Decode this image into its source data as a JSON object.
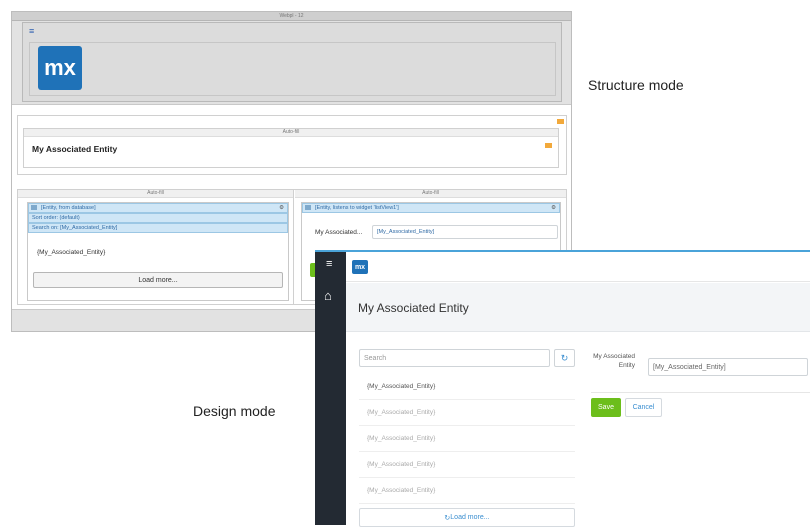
{
  "captions": {
    "structure": "Structure mode",
    "design": "Design mode"
  },
  "structure": {
    "top_header_label": "Webpl - 12",
    "menu_icon_glyph": "≡",
    "logo_text": "mx",
    "header_layout_label": "Auto-fill",
    "page_title": "My Associated Entity",
    "left_column_label": "Auto-fill",
    "right_column_label": "Auto-fill",
    "list_view": {
      "datasource": "[Entity, from database]",
      "sort_order": "Sort order: (default)",
      "search_on": "Search on: [My_Associated_Entity]",
      "item_text": "{My_Associated_Entity}",
      "load_more": "Load more..."
    },
    "data_view": {
      "datasource": "[Entity, listens to widget 'listView1']",
      "field_label": "My Associated...",
      "field_value": "[My_Associated_Entity]"
    }
  },
  "design": {
    "menu_icon_glyph": "≡",
    "home_icon_glyph": "⌂",
    "logo_text": "mx",
    "page_title": "My Associated Entity",
    "search_placeholder": "Search",
    "refresh_icon_glyph": "↻",
    "list_items": [
      "{My_Associated_Entity}",
      "{My_Associated_Entity}",
      "{My_Associated_Entity}",
      "{My_Associated_Entity}",
      "{My_Associated_Entity}"
    ],
    "load_more_icon_glyph": "↻",
    "load_more": "Load more...",
    "field_label": "My Associated Entity",
    "field_value": "[My_Associated_Entity]",
    "save_label": "Save",
    "cancel_label": "Cancel"
  },
  "colors": {
    "brand_blue": "#1f72b8",
    "save_green": "#6cbe1b",
    "sidebar_dark": "#232a33",
    "selection_blue": "#cfe6f6"
  }
}
